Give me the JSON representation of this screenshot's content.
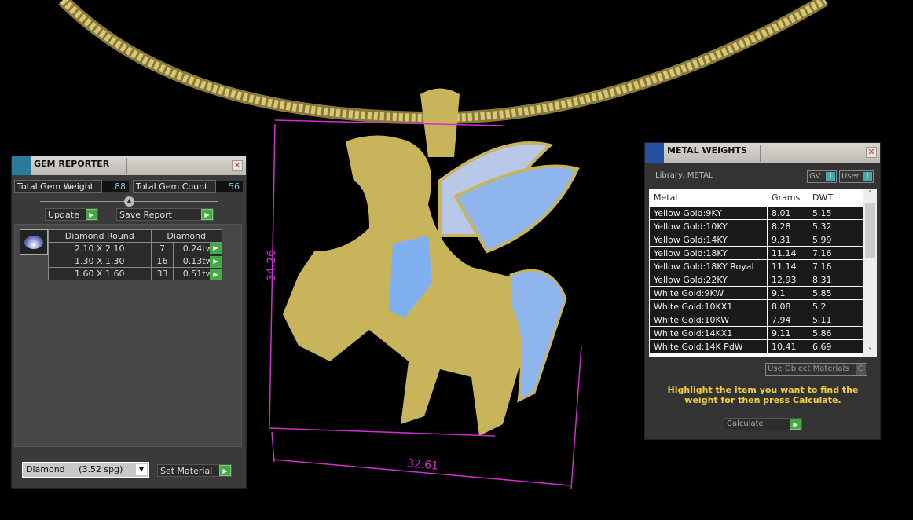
{
  "viewport": {
    "dimension_height": "34.26",
    "dimension_width": "32.61",
    "dimension_color": "#d030d0",
    "metal_color": "#c8b45a",
    "gem_color": "#7fb0f0"
  },
  "gem_reporter": {
    "title": "GEM REPORTER",
    "total_weight_label": "Total Gem Weight",
    "total_weight": ".88",
    "total_count_label": "Total Gem Count",
    "total_count": "56",
    "update_label": "Update",
    "save_report_label": "Save Report",
    "table": {
      "header": [
        "Diamond Round",
        "Diamond"
      ],
      "rows": [
        [
          "2.10 X 2.10",
          "7",
          "0.24tw"
        ],
        [
          "1.30 X 1.30",
          "16",
          "0.13tw"
        ],
        [
          "1.60 X 1.60",
          "33",
          "0.51tw"
        ]
      ]
    },
    "material_select": "Diamond     (3.52 spg)",
    "set_material_label": "Set Material"
  },
  "metal_weights": {
    "title": "METAL WEIGHTS",
    "library_label": "Library: METAL",
    "gv_label": "GV",
    "user_label": "User",
    "columns": [
      "Metal",
      "Grams",
      "DWT"
    ],
    "rows": [
      [
        "Yellow Gold:9KY",
        "8.01",
        "5.15"
      ],
      [
        "Yellow Gold:10KY",
        "8.28",
        "5.32"
      ],
      [
        "Yellow Gold:14KY",
        "9.31",
        "5.99"
      ],
      [
        "Yellow Gold:18KY",
        "11.14",
        "7.16"
      ],
      [
        "Yellow Gold:18KY Royal",
        "11.14",
        "7.16"
      ],
      [
        "Yellow Gold:22KY",
        "12.93",
        "8.31"
      ],
      [
        "White Gold:9KW",
        "9.1",
        "5.85"
      ],
      [
        "White Gold:10KX1",
        "8.08",
        "5.2"
      ],
      [
        "White Gold:10KW",
        "7.94",
        "5.11"
      ],
      [
        "White Gold:14KX1",
        "9.11",
        "5.86"
      ],
      [
        "White Gold:14K PdW",
        "10.41",
        "6.69"
      ]
    ],
    "use_object_materials_label": "Use Object Materials",
    "instruction": "Highlight the item you want to find the weight for then press Calculate.",
    "calculate_label": "Calculate"
  }
}
